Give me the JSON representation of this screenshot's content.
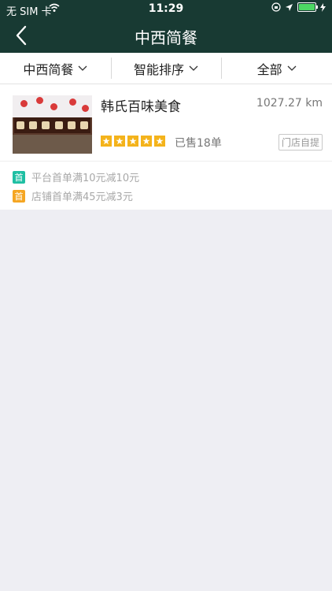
{
  "status_bar": {
    "carrier": "无 SIM 卡",
    "time": "11:29"
  },
  "nav": {
    "title": "中西简餐"
  },
  "filters": [
    {
      "label": "中西简餐"
    },
    {
      "label": "智能排序"
    },
    {
      "label": "全部"
    }
  ],
  "shop": {
    "name": "韩氏百味美食",
    "distance": "1027.27 km",
    "rating_stars": 5,
    "sold": "已售18单",
    "pickup_tag": "门店自提"
  },
  "promotions": [
    {
      "badge": "首",
      "badge_color": "#1fbfa3",
      "text": "平台首单满10元减10元"
    },
    {
      "badge": "首",
      "badge_color": "#f5a623",
      "text": "店铺首单满45元减3元"
    }
  ],
  "colors": {
    "header_bg": "#183a33",
    "star": "#f4b31b",
    "battery": "#4cd964"
  }
}
